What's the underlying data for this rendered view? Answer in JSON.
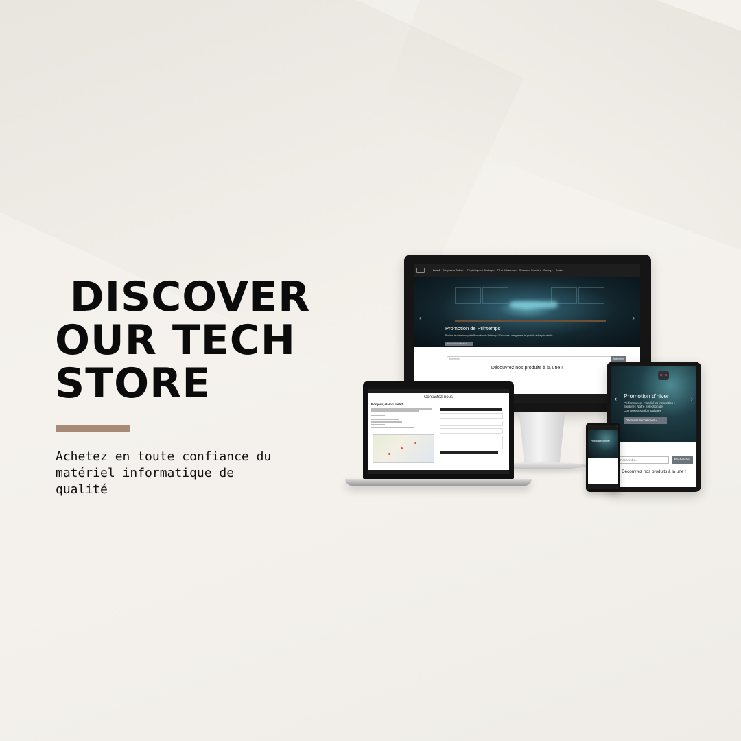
{
  "hero": {
    "headline": " DISCOVER\nOUR TECH\nSTORE",
    "subtitle": "Achetez en toute confiance du matériel informatique de qualité",
    "accent_color": "#a88b76"
  },
  "monitor_site": {
    "nav_items": [
      "Accueil",
      "Composants Ordinat ▾",
      "Périphériques et Stockage ▾",
      "PC et Ordinateurs ▾",
      "Réseaux et Sécurité ▾",
      "Gaming ▾",
      "Contact"
    ],
    "slide_title": "Promotion de Printemps",
    "slide_text": "Profitez de notre incroyable Promotion de Printemps ! Découvrez une gamme de produits à des prix réduits.",
    "slide_button": "Découvrir la collection",
    "search_placeholder": "Recherche...",
    "search_button": "Rechercher",
    "featured_heading": "Découvrez nos produits à la une !"
  },
  "laptop_site": {
    "page_title": "Contactez-nous",
    "greeting": "Bonjour, elamri mehdi",
    "form_button": "Envoyer le message"
  },
  "tablet_site": {
    "slide_title": "Promotion d'hiver",
    "slide_text": "Performance, Fiabilité et Innovation : Explorez Notre Sélection de Composants Informatiques",
    "slide_button": "Découvrir la collection »",
    "search_placeholder": "Recherche...",
    "search_button": "Rechercher",
    "featured_heading": "Découvrez nos produits à la une !"
  },
  "phone_site": {
    "slide_title": "Promotion d'hiver"
  }
}
